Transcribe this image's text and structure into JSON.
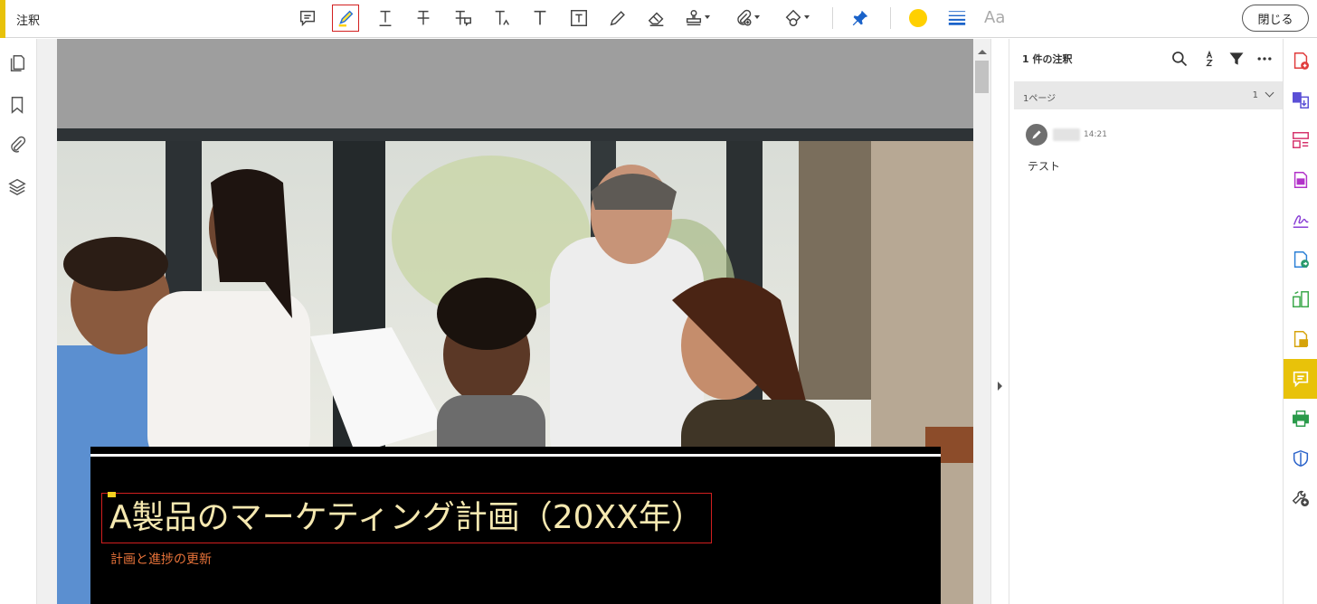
{
  "toolbar": {
    "mode_title": "注釈",
    "tools": [
      {
        "name": "sticky-note-icon"
      },
      {
        "name": "highlight-pen-icon",
        "selected": true
      },
      {
        "name": "underline-text-icon"
      },
      {
        "name": "strikethrough-text-icon"
      },
      {
        "name": "replace-text-icon"
      },
      {
        "name": "insert-text-icon"
      },
      {
        "name": "add-text-icon"
      },
      {
        "name": "text-box-icon"
      },
      {
        "name": "pencil-icon"
      },
      {
        "name": "eraser-icon"
      },
      {
        "name": "stamp-icon"
      },
      {
        "name": "attach-file-icon"
      },
      {
        "name": "shapes-icon"
      },
      {
        "name": "pin-icon"
      },
      {
        "name": "line-weight-icon"
      }
    ],
    "aa_label": "Aa",
    "color": "#ffd000",
    "close_label": "閉じる"
  },
  "left_nav": [
    "pages-icon",
    "bookmark-icon",
    "attachment-icon",
    "layers-icon"
  ],
  "document": {
    "title": "A製品のマーケティング計画（20XX年）",
    "subtitle": "計画と進捗の更新"
  },
  "comments_panel": {
    "count_label": "1 件の注釈",
    "page_label": "1ページ",
    "page_count": "1",
    "comments": [
      {
        "time": "14:21",
        "text": "テスト"
      }
    ]
  },
  "right_rail": [
    "create-pdf-icon",
    "combine-files-icon",
    "organize-pages-icon",
    "export-pdf-icon",
    "fill-sign-icon",
    "send-for-review-icon",
    "edit-pdf-icon",
    "export-doc-icon",
    "comment-icon",
    "print-production-icon",
    "protect-icon",
    "more-tools-icon"
  ],
  "colors": {
    "accent": "#e8c20a",
    "selection": "#d21f1f",
    "title_text": "#f5e8b0",
    "subtitle_text": "#e8733a"
  }
}
